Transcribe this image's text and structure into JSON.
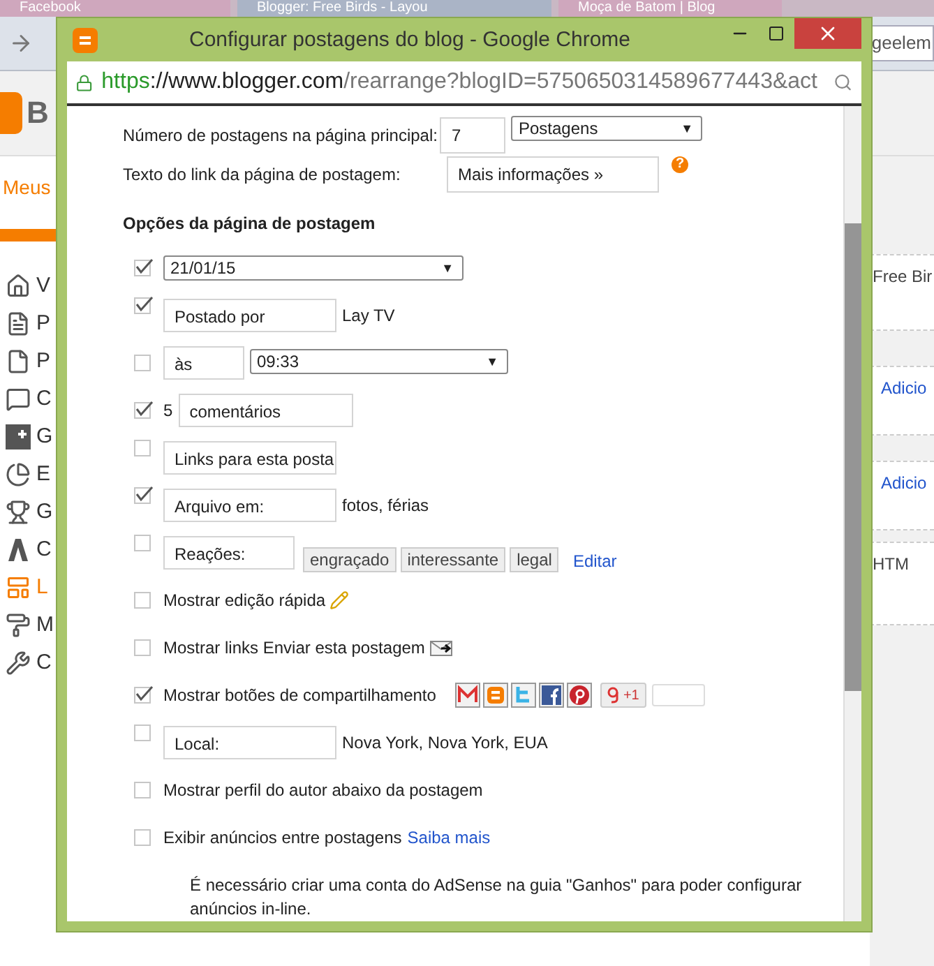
{
  "tabs": [
    {
      "label": "Facebook",
      "selected": false
    },
    {
      "label": "Blogger: Free Birds - Layou",
      "selected": true
    },
    {
      "label": "Moça de Batom | Blog",
      "selected": false
    }
  ],
  "background": {
    "address_fragment": "geelem",
    "header_fragment": "B",
    "menu_heading": "Meus",
    "sidebar_items": [
      {
        "label": "V",
        "selected": false
      },
      {
        "label": "P",
        "selected": false
      },
      {
        "label": "P",
        "selected": false
      },
      {
        "label": "C",
        "selected": false
      },
      {
        "label": "G",
        "selected": false
      },
      {
        "label": "E",
        "selected": false
      },
      {
        "label": "G",
        "selected": false
      },
      {
        "label": "C",
        "selected": false
      },
      {
        "label": "L",
        "selected": true
      },
      {
        "label": "M",
        "selected": false
      },
      {
        "label": "C",
        "selected": false
      }
    ],
    "panel_texts": [
      {
        "kind": "plain",
        "text": "Free Bir"
      },
      {
        "kind": "link",
        "text": "Adicio"
      },
      {
        "kind": "link",
        "text": "Adicio"
      },
      {
        "kind": "plain",
        "text": "HTM"
      }
    ]
  },
  "dialog": {
    "title": "Configurar postagens do blog - Google Chrome",
    "url_scheme": "https",
    "url_host": "://www.blogger.com",
    "url_path": "/rearrange?blogID=5750650314589677443&act",
    "main_page": {
      "posts_label": "Número de postagens na página principal:",
      "posts_value": "7",
      "posts_unit": "Postagens",
      "posts_caret": "▼",
      "link_label": "Texto do link da página de postagem:",
      "link_value": "Mais informações »",
      "help": "?"
    },
    "post_page": {
      "heading": "Opções da página de postagem",
      "options": [
        {
          "kind": "date",
          "checked": true,
          "value": "21/01/15",
          "caret": "▼"
        },
        {
          "kind": "field",
          "checked": true,
          "value": "Postado por",
          "text": "Lay TV"
        },
        {
          "kind": "time",
          "checked": false,
          "value": "às",
          "time": "09:33",
          "caret": "▼"
        },
        {
          "kind": "count",
          "checked": true,
          "count": "5",
          "value": "comentários"
        },
        {
          "kind": "field",
          "checked": false,
          "value": "Links para esta posta"
        },
        {
          "kind": "field",
          "checked": true,
          "value": "Arquivo em:",
          "text": "fotos, férias"
        },
        {
          "kind": "reactions",
          "checked": false,
          "value": "Reações:",
          "tags": [
            "engraçado",
            "interessante",
            "legal"
          ],
          "link": "Editar"
        },
        {
          "kind": "quick_edit",
          "checked": false,
          "label": "Mostrar edição rápida"
        },
        {
          "kind": "email",
          "checked": false,
          "label": "Mostrar links Enviar esta postagem"
        },
        {
          "kind": "share",
          "checked": true,
          "label": "Mostrar botões de compartilhamento",
          "plus_one": "+1"
        },
        {
          "kind": "field",
          "checked": false,
          "value": "Local:",
          "text": "Nova York, Nova York, EUA"
        },
        {
          "kind": "plain",
          "checked": false,
          "label": "Mostrar perfil do autor abaixo da postagem"
        },
        {
          "kind": "plain",
          "checked": false,
          "label": "Exibir anúncios entre postagens",
          "link": "Saiba mais"
        }
      ],
      "note": "É necessário criar uma conta do AdSense na guia \"Ganhos\" para poder configurar anúncios in-line."
    }
  }
}
